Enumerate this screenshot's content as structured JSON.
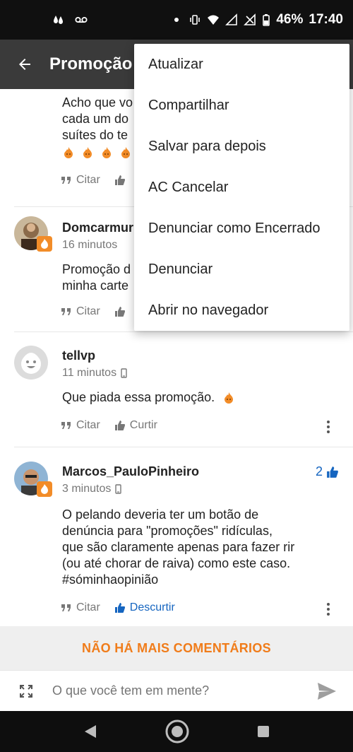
{
  "status": {
    "battery": "46%",
    "time": "17:40"
  },
  "appbar": {
    "title": "Promoção"
  },
  "comments": [
    {
      "text_lines": [
        "Acho que vo",
        "cada um do",
        "suítes do te"
      ],
      "cite": "Citar"
    },
    {
      "author": "Domcarmur",
      "time": "16 minutos",
      "text_lines": [
        "Promoção d",
        "minha carte"
      ],
      "cite": "Citar"
    },
    {
      "author": "tellvp",
      "time": "11 minutos",
      "text": "Que piada essa promoção.",
      "cite": "Citar",
      "like": "Curtir"
    },
    {
      "author": "Marcos_PauloPinheiro",
      "time": "3 minutos",
      "likes": "2",
      "text_lines": [
        "O pelando deveria ter um botão de",
        "denúncia para \"promoções\" ridículas,",
        "que são claramente apenas para fazer rir",
        "(ou até chorar de raiva) como este caso.",
        "#sóminhaopinião"
      ],
      "cite": "Citar",
      "like": "Descurtir"
    }
  ],
  "footer": {
    "no_more": "NÃO HÁ MAIS COMENTÁRIOS"
  },
  "input": {
    "placeholder": "O que você tem em mente?"
  },
  "menu": {
    "items": [
      "Atualizar",
      "Compartilhar",
      "Salvar para depois",
      "AC Cancelar",
      "Denunciar como Encerrado",
      "Denunciar",
      "Abrir no navegador"
    ]
  },
  "colors": {
    "accent": "#f07c1a",
    "link": "#1565c0",
    "appbar": "#3a3a3a"
  }
}
